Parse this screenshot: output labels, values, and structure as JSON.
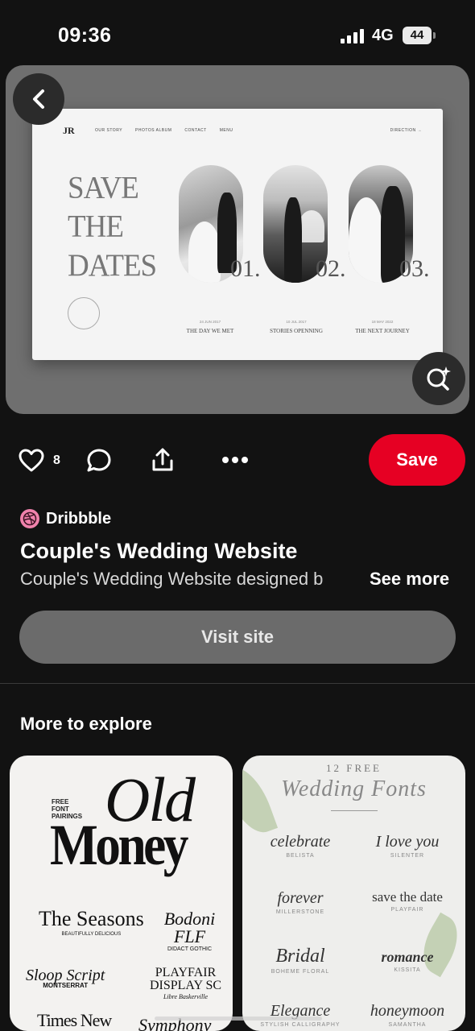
{
  "status_bar": {
    "time": "09:36",
    "network": "4G",
    "battery": "44"
  },
  "pin_image": {
    "logo": "JR",
    "nav": [
      "OUR STORY",
      "PHOTOS ALBUM",
      "CONTACT",
      "MENU"
    ],
    "direction": "DIRECTION →",
    "headline": [
      "SAVE",
      "THE",
      "DATES"
    ],
    "moments": [
      {
        "num": "01.",
        "date": "24 JUN 2017",
        "caption": "THE DAY WE MET"
      },
      {
        "num": "02.",
        "date": "10 JUL 2017",
        "caption": "STORIES OPENNING"
      },
      {
        "num": "03.",
        "date": "18 MAY 2022",
        "caption": "THE NEXT JOURNEY"
      }
    ]
  },
  "actions": {
    "like_count": "8",
    "save_label": "Save"
  },
  "source": {
    "name": "Dribbble"
  },
  "pin": {
    "title": "Couple's Wedding Website",
    "description": "Couple's Wedding Website designed b",
    "see_more": "See more",
    "visit_label": "Visit site"
  },
  "explore": {
    "heading": "More to explore",
    "card1": {
      "small": [
        "FREE",
        "FONT",
        "PAIRINGS"
      ],
      "old": "Old",
      "money": "Money",
      "seasons": "The Seasons",
      "seasons_sub": "BEAUTIFULLY DELICIOUS",
      "bodoni": "Bodoni FLF",
      "bodoni_sub": "DIDACT GOTHIC",
      "sloop": "Sloop Script",
      "sloop_sub": "MONTSERRAT",
      "playfair": "PLAYFAIR DISPLAY SC",
      "playfair_sub": "Libre Baskerville",
      "times": "Times New",
      "symphony": "Symphony"
    },
    "card2": {
      "head": "12 FREE",
      "title": "Wedding Fonts",
      "items": [
        {
          "script": "celebrate",
          "label": "BELISTA"
        },
        {
          "script": "I love you",
          "label": "SILENTER"
        },
        {
          "script": "forever",
          "label": "MILLERSTONE"
        },
        {
          "script": "save the date",
          "label": "PLAYFAIR"
        },
        {
          "script": "Bridal",
          "label": "BOHEME FLORAL"
        },
        {
          "script": "romance",
          "label": "KISSITA"
        },
        {
          "script": "Elegance",
          "label": "STYLISH CALLIGRAPHY"
        },
        {
          "script": "honeymoon",
          "label": "SAMANTHA"
        }
      ]
    }
  }
}
